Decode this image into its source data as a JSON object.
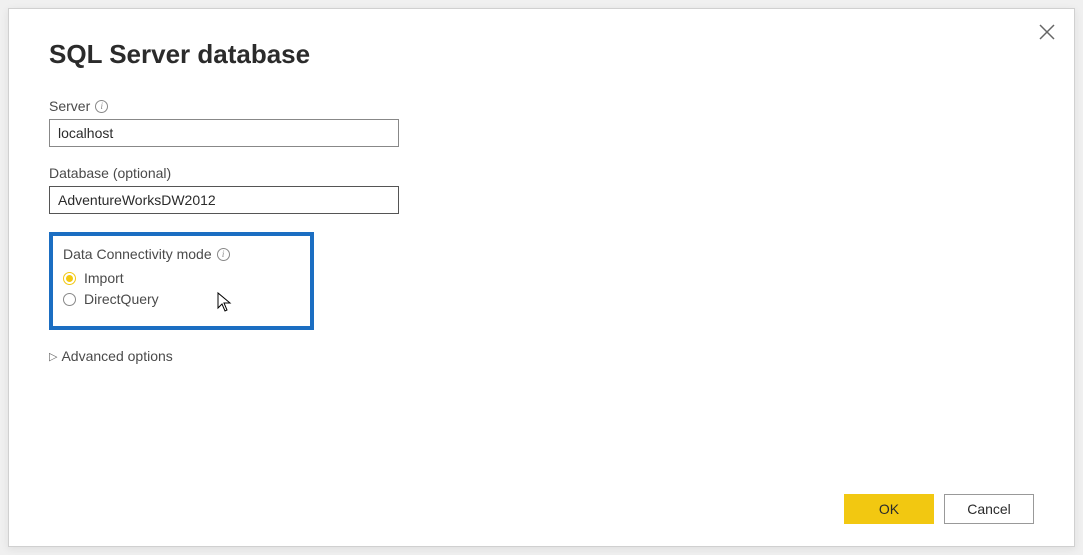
{
  "dialog": {
    "title": "SQL Server database",
    "server": {
      "label": "Server",
      "value": "localhost"
    },
    "database": {
      "label": "Database (optional)",
      "value": "AdventureWorksDW2012"
    },
    "connectivity": {
      "title": "Data Connectivity mode",
      "options": {
        "import": "Import",
        "direct": "DirectQuery"
      },
      "selected": "import"
    },
    "advanced": {
      "label": "Advanced options"
    },
    "buttons": {
      "ok": "OK",
      "cancel": "Cancel"
    }
  }
}
